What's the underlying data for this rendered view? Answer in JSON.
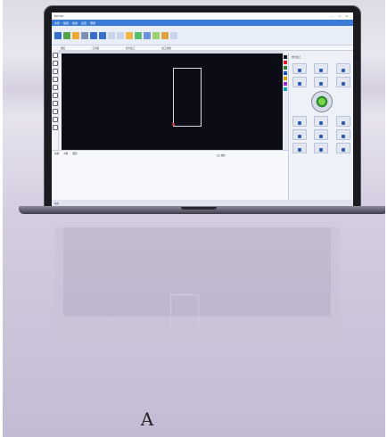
{
  "caption": "A",
  "app": {
    "title": "EzCAD",
    "window_controls": [
      "—",
      "□",
      "✕"
    ],
    "menu": [
      "文件",
      "编辑",
      "绘制",
      "设置",
      "帮助"
    ],
    "subbar": [
      "图层",
      "工具箱",
      "激光加工",
      "加工参数"
    ],
    "bottom_tabs": [
      "系统",
      "对象",
      "图层"
    ],
    "params_title": "加工参数",
    "rightpanel_title": "激光加工",
    "status_text": "就绪",
    "colors": [
      "#1a1a1a",
      "#d22",
      "#2b7d2b",
      "#1d4fb2",
      "#d9a000",
      "#9a2cc0",
      "#1aa0b8"
    ]
  }
}
